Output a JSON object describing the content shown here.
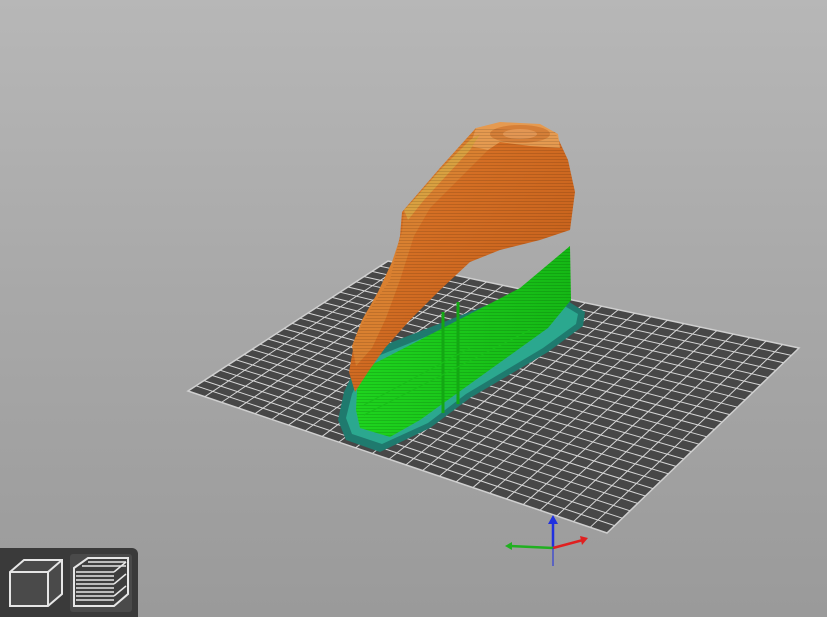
{
  "colors": {
    "bed": "#474747",
    "grid": "#d8d8d8",
    "skirt": "#1f7a6e",
    "brim": "#2ba88f",
    "support": "#1ed41e",
    "support_dark": "#13b013",
    "perimeter": "#d4691f",
    "perimeter_dark": "#b85515",
    "top_fill": "#e08a38",
    "axis_x": "#e02020",
    "axis_y": "#20b020",
    "axis_z": "#2030e0",
    "toolbar": "#3a3a3a"
  },
  "toolbar": {
    "buttons": [
      {
        "name": "3d-view",
        "icon": "cube-icon"
      },
      {
        "name": "preview",
        "icon": "layers-icon",
        "active": true
      }
    ]
  }
}
